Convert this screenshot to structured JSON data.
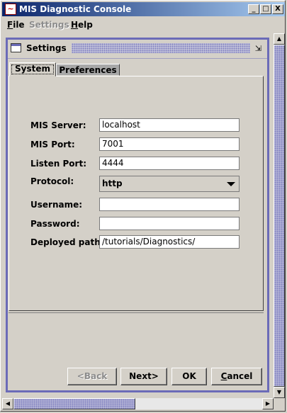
{
  "window": {
    "title": "MIS Diagnostic Console",
    "minimize": "_",
    "maximize": "□",
    "close": "X"
  },
  "menubar": {
    "items": [
      {
        "first": "F",
        "rest": "ile",
        "enabled": true
      },
      {
        "first": "",
        "rest": "Settings",
        "enabled": false
      },
      {
        "first": "H",
        "rest": "elp",
        "enabled": true
      }
    ]
  },
  "internal_frame": {
    "title": "Settings"
  },
  "tabs": [
    {
      "label": "System",
      "active": true
    },
    {
      "label": "Preferences",
      "active": false
    }
  ],
  "form": {
    "mis_server": {
      "label": "MIS Server:",
      "value": "localhost"
    },
    "mis_port": {
      "label": "MIS Port:",
      "value": "7001"
    },
    "listen_port": {
      "label": "Listen Port:",
      "value": "4444"
    },
    "protocol": {
      "label": "Protocol:",
      "value": "http"
    },
    "username": {
      "label": "Username:",
      "value": ""
    },
    "password": {
      "label": "Password:",
      "value": ""
    },
    "deployed_path": {
      "label": "Deployed path:",
      "value": "/tutorials/Diagnostics/"
    }
  },
  "buttons": {
    "back": {
      "label": "<Back",
      "enabled": false
    },
    "next": {
      "label": "Next>",
      "enabled": true
    },
    "ok": {
      "label": "OK",
      "enabled": true
    },
    "cancel_first": "C",
    "cancel_rest": "ancel"
  },
  "scrollbars": {
    "up": "▲",
    "down": "▼",
    "left": "◀",
    "right": "▶"
  }
}
